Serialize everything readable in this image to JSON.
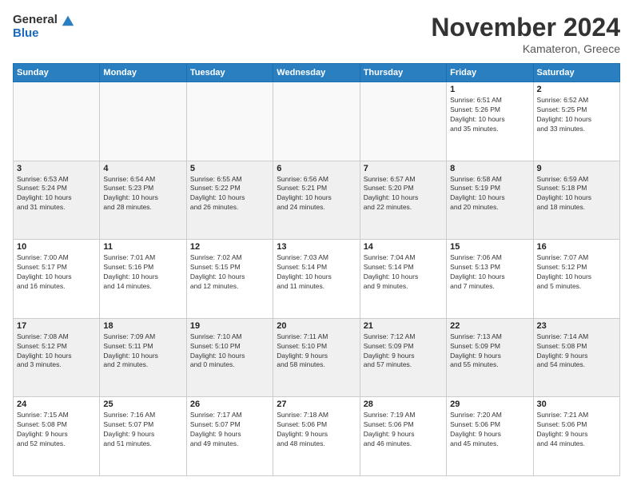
{
  "logo": {
    "general": "General",
    "blue": "Blue"
  },
  "header": {
    "month": "November 2024",
    "location": "Kamateron, Greece"
  },
  "weekdays": [
    "Sunday",
    "Monday",
    "Tuesday",
    "Wednesday",
    "Thursday",
    "Friday",
    "Saturday"
  ],
  "weeks": [
    [
      {
        "day": "",
        "info": ""
      },
      {
        "day": "",
        "info": ""
      },
      {
        "day": "",
        "info": ""
      },
      {
        "day": "",
        "info": ""
      },
      {
        "day": "",
        "info": ""
      },
      {
        "day": "1",
        "info": "Sunrise: 6:51 AM\nSunset: 5:26 PM\nDaylight: 10 hours\nand 35 minutes."
      },
      {
        "day": "2",
        "info": "Sunrise: 6:52 AM\nSunset: 5:25 PM\nDaylight: 10 hours\nand 33 minutes."
      }
    ],
    [
      {
        "day": "3",
        "info": "Sunrise: 6:53 AM\nSunset: 5:24 PM\nDaylight: 10 hours\nand 31 minutes."
      },
      {
        "day": "4",
        "info": "Sunrise: 6:54 AM\nSunset: 5:23 PM\nDaylight: 10 hours\nand 28 minutes."
      },
      {
        "day": "5",
        "info": "Sunrise: 6:55 AM\nSunset: 5:22 PM\nDaylight: 10 hours\nand 26 minutes."
      },
      {
        "day": "6",
        "info": "Sunrise: 6:56 AM\nSunset: 5:21 PM\nDaylight: 10 hours\nand 24 minutes."
      },
      {
        "day": "7",
        "info": "Sunrise: 6:57 AM\nSunset: 5:20 PM\nDaylight: 10 hours\nand 22 minutes."
      },
      {
        "day": "8",
        "info": "Sunrise: 6:58 AM\nSunset: 5:19 PM\nDaylight: 10 hours\nand 20 minutes."
      },
      {
        "day": "9",
        "info": "Sunrise: 6:59 AM\nSunset: 5:18 PM\nDaylight: 10 hours\nand 18 minutes."
      }
    ],
    [
      {
        "day": "10",
        "info": "Sunrise: 7:00 AM\nSunset: 5:17 PM\nDaylight: 10 hours\nand 16 minutes."
      },
      {
        "day": "11",
        "info": "Sunrise: 7:01 AM\nSunset: 5:16 PM\nDaylight: 10 hours\nand 14 minutes."
      },
      {
        "day": "12",
        "info": "Sunrise: 7:02 AM\nSunset: 5:15 PM\nDaylight: 10 hours\nand 12 minutes."
      },
      {
        "day": "13",
        "info": "Sunrise: 7:03 AM\nSunset: 5:14 PM\nDaylight: 10 hours\nand 11 minutes."
      },
      {
        "day": "14",
        "info": "Sunrise: 7:04 AM\nSunset: 5:14 PM\nDaylight: 10 hours\nand 9 minutes."
      },
      {
        "day": "15",
        "info": "Sunrise: 7:06 AM\nSunset: 5:13 PM\nDaylight: 10 hours\nand 7 minutes."
      },
      {
        "day": "16",
        "info": "Sunrise: 7:07 AM\nSunset: 5:12 PM\nDaylight: 10 hours\nand 5 minutes."
      }
    ],
    [
      {
        "day": "17",
        "info": "Sunrise: 7:08 AM\nSunset: 5:12 PM\nDaylight: 10 hours\nand 3 minutes."
      },
      {
        "day": "18",
        "info": "Sunrise: 7:09 AM\nSunset: 5:11 PM\nDaylight: 10 hours\nand 2 minutes."
      },
      {
        "day": "19",
        "info": "Sunrise: 7:10 AM\nSunset: 5:10 PM\nDaylight: 10 hours\nand 0 minutes."
      },
      {
        "day": "20",
        "info": "Sunrise: 7:11 AM\nSunset: 5:10 PM\nDaylight: 9 hours\nand 58 minutes."
      },
      {
        "day": "21",
        "info": "Sunrise: 7:12 AM\nSunset: 5:09 PM\nDaylight: 9 hours\nand 57 minutes."
      },
      {
        "day": "22",
        "info": "Sunrise: 7:13 AM\nSunset: 5:09 PM\nDaylight: 9 hours\nand 55 minutes."
      },
      {
        "day": "23",
        "info": "Sunrise: 7:14 AM\nSunset: 5:08 PM\nDaylight: 9 hours\nand 54 minutes."
      }
    ],
    [
      {
        "day": "24",
        "info": "Sunrise: 7:15 AM\nSunset: 5:08 PM\nDaylight: 9 hours\nand 52 minutes."
      },
      {
        "day": "25",
        "info": "Sunrise: 7:16 AM\nSunset: 5:07 PM\nDaylight: 9 hours\nand 51 minutes."
      },
      {
        "day": "26",
        "info": "Sunrise: 7:17 AM\nSunset: 5:07 PM\nDaylight: 9 hours\nand 49 minutes."
      },
      {
        "day": "27",
        "info": "Sunrise: 7:18 AM\nSunset: 5:06 PM\nDaylight: 9 hours\nand 48 minutes."
      },
      {
        "day": "28",
        "info": "Sunrise: 7:19 AM\nSunset: 5:06 PM\nDaylight: 9 hours\nand 46 minutes."
      },
      {
        "day": "29",
        "info": "Sunrise: 7:20 AM\nSunset: 5:06 PM\nDaylight: 9 hours\nand 45 minutes."
      },
      {
        "day": "30",
        "info": "Sunrise: 7:21 AM\nSunset: 5:06 PM\nDaylight: 9 hours\nand 44 minutes."
      }
    ]
  ]
}
